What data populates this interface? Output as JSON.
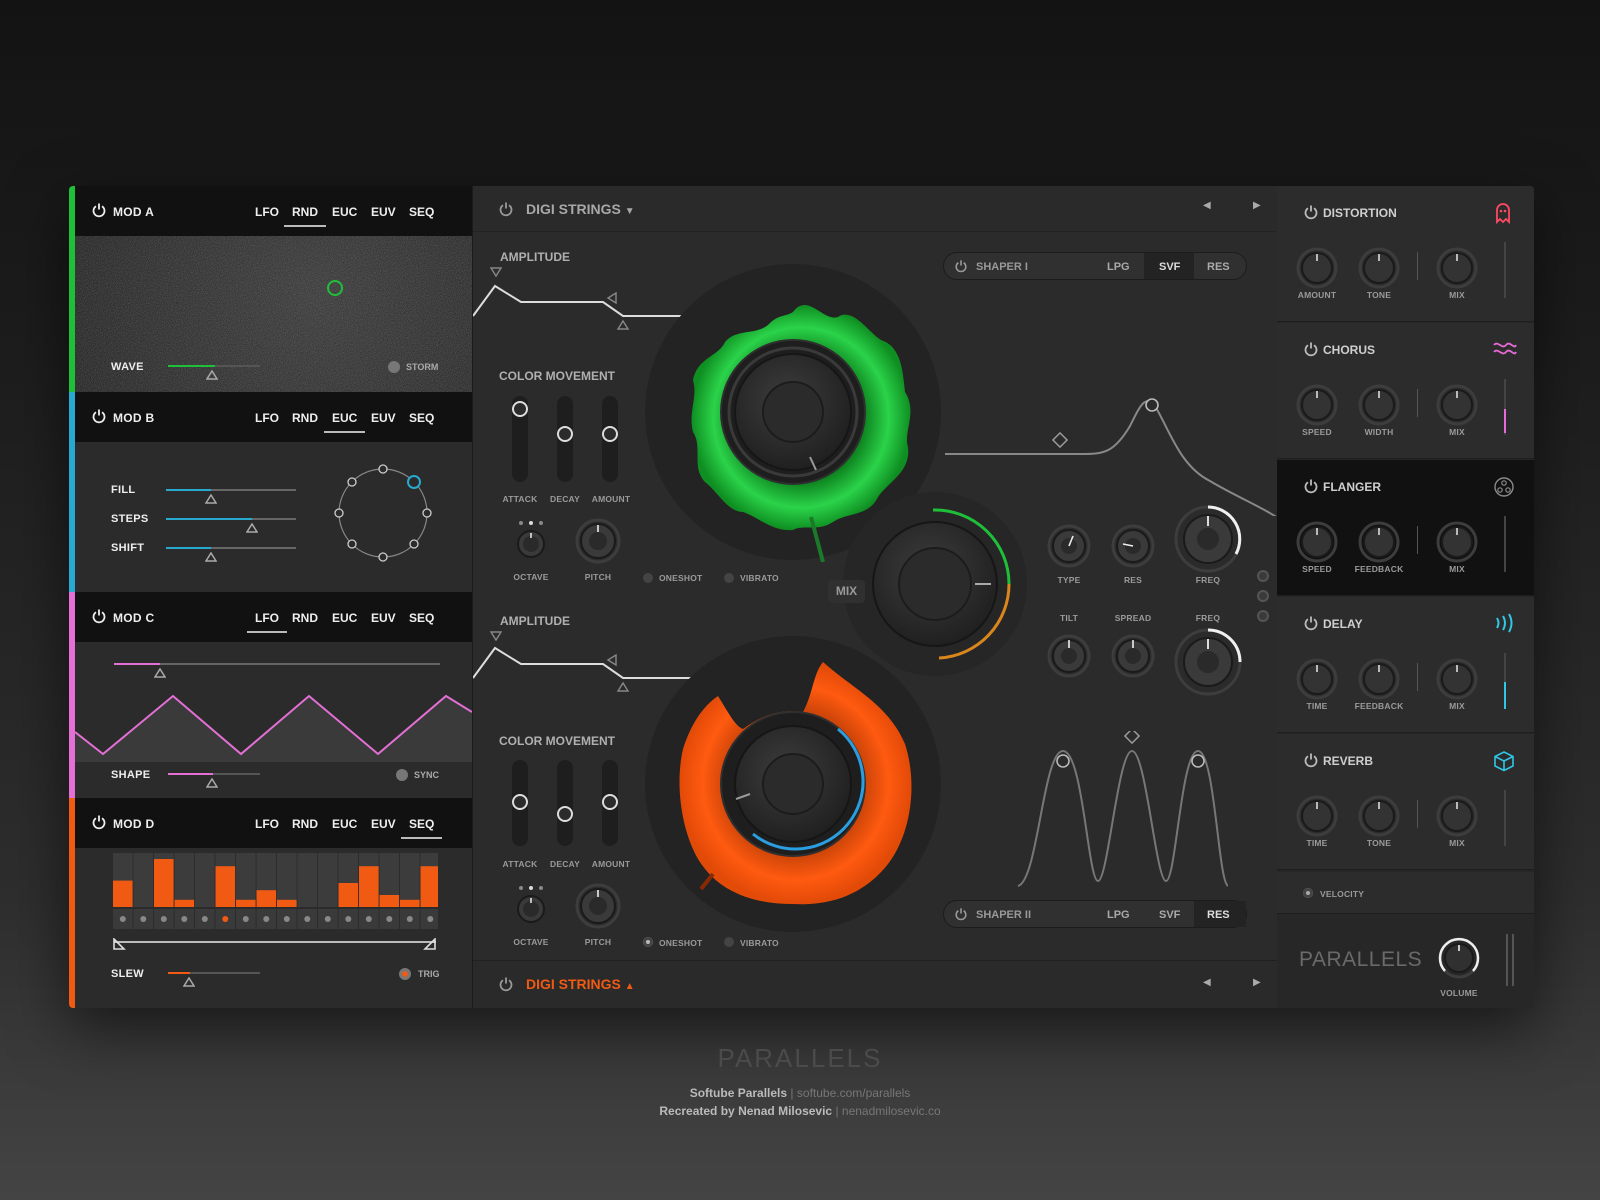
{
  "mods": [
    {
      "title": "MOD A",
      "active_tab": "RND",
      "color": "#1fbf3a",
      "labels": {
        "wave": "WAVE",
        "storm": "STORM"
      }
    },
    {
      "title": "MOD B",
      "active_tab": "EUC",
      "color": "#27a9d0",
      "labels": {
        "fill": "FILL",
        "steps": "STEPS",
        "shift": "SHIFT"
      }
    },
    {
      "title": "MOD C",
      "active_tab": "LFO",
      "color": "#e470d6",
      "labels": {
        "shape": "SHAPE",
        "sync": "SYNC"
      }
    },
    {
      "title": "MOD D",
      "active_tab": "SEQ",
      "color": "#f05a12",
      "labels": {
        "slew": "SLEW",
        "trig": "TRIG"
      }
    }
  ],
  "mod_tabs": [
    "LFO",
    "RND",
    "EUC",
    "EUV",
    "SEQ"
  ],
  "seq_steps": [
    0.55,
    0,
    1.0,
    0.15,
    0,
    0.85,
    0.15,
    0.35,
    0.15,
    0,
    0,
    0.5,
    0.85,
    0.25,
    0.15,
    0.85
  ],
  "seq_active_step": 5,
  "engines": [
    {
      "title": "DIGI STRINGS",
      "arrow": "▼",
      "title_color": "#a8a8a8",
      "amplitude": "AMPLITUDE",
      "color_movement": "COLOR MOVEMENT",
      "sliders": [
        "ATTACK",
        "DECAY",
        "AMOUNT"
      ],
      "octave": "OCTAVE",
      "pitch": "PITCH",
      "oneshot": "ONESHOT",
      "vibrato": "VIBRATO"
    },
    {
      "title": "DIGI STRINGS",
      "arrow": "▲",
      "title_color": "#f05a12",
      "amplitude": "AMPLITUDE",
      "color_movement": "COLOR MOVEMENT",
      "sliders": [
        "ATTACK",
        "DECAY",
        "AMOUNT"
      ],
      "octave": "OCTAVE",
      "pitch": "PITCH",
      "oneshot": "ONESHOT",
      "vibrato": "VIBRATO"
    }
  ],
  "shapers": [
    {
      "title": "SHAPER I",
      "modes": [
        "LPG",
        "SVF",
        "RES"
      ],
      "active": "SVF"
    },
    {
      "title": "SHAPER II",
      "modes": [
        "LPG",
        "SVF",
        "RES"
      ],
      "active": "RES"
    }
  ],
  "mix_label": "MIX",
  "filter_knobs_top": [
    "TYPE",
    "RES",
    "FREQ"
  ],
  "filter_knobs_bottom": [
    "TILT",
    "SPREAD",
    "FREQ"
  ],
  "effects": [
    {
      "name": "DISTORTION",
      "knobs": [
        "AMOUNT",
        "TONE",
        "MIX"
      ],
      "icon": "ghost-icon",
      "color": "#ff4a64"
    },
    {
      "name": "CHORUS",
      "knobs": [
        "SPEED",
        "WIDTH",
        "MIX"
      ],
      "icon": "wave-icon",
      "color": "#e86ad8"
    },
    {
      "name": "FLANGER",
      "knobs": [
        "SPEED",
        "FEEDBACK",
        "MIX"
      ],
      "icon": "flanger-icon",
      "color": "#8a8a8a"
    },
    {
      "name": "DELAY",
      "knobs": [
        "TIME",
        "FEEDBACK",
        "MIX"
      ],
      "icon": "signal-icon",
      "color": "#30c6e6"
    },
    {
      "name": "REVERB",
      "knobs": [
        "TIME",
        "TONE",
        "MIX"
      ],
      "icon": "cube-icon",
      "color": "#30c6e6"
    }
  ],
  "velocity": "VELOCITY",
  "brand": "PARALLELS",
  "volume": "VOLUME",
  "footer": {
    "title": "PARALLELS",
    "line1_strong": "Softube Parallels",
    "line1_link": "softube.com/parallels",
    "line2_strong": "Recreated by Nenad Milosevic",
    "line2_link": "nenadmilosevic.co",
    "separator": "|"
  }
}
